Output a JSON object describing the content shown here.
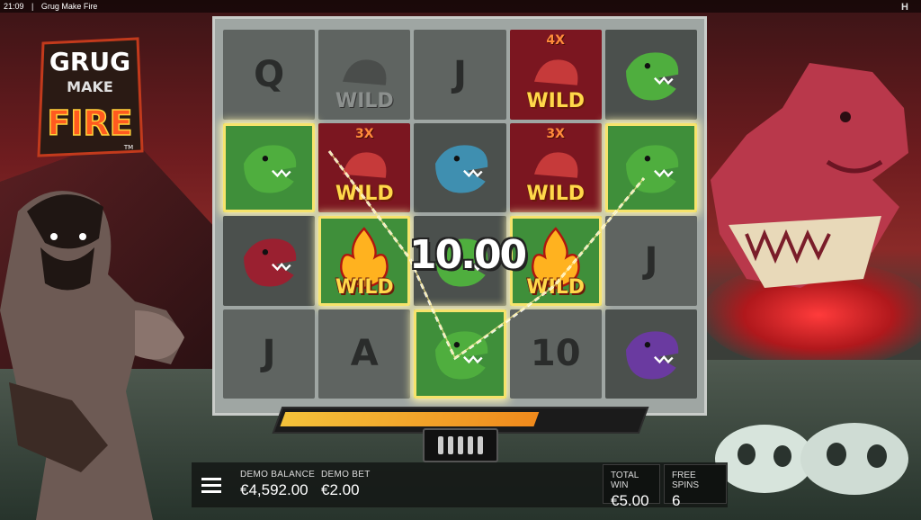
{
  "status_bar": {
    "time": "21:09",
    "separator": "|",
    "title": "Grug Make Fire",
    "provider_mark": "H"
  },
  "logo": {
    "line1": "GRUG",
    "line2": "MAKE",
    "line3": "FIRE",
    "tm": "TM"
  },
  "reels": [
    [
      {
        "type": "letter",
        "label": "Q"
      },
      {
        "type": "wild",
        "label": "WILD",
        "mult": ""
      },
      {
        "type": "letter",
        "label": "J"
      },
      {
        "type": "wild",
        "label": "WILD",
        "mult": "4X"
      },
      {
        "type": "dino",
        "color": "green",
        "label": ""
      }
    ],
    [
      {
        "type": "dino",
        "color": "green",
        "label": "",
        "win": true
      },
      {
        "type": "wild",
        "label": "WILD",
        "mult": "3X"
      },
      {
        "type": "dino",
        "color": "blue",
        "label": ""
      },
      {
        "type": "wild",
        "label": "WILD",
        "mult": "3X"
      },
      {
        "type": "dino",
        "color": "green",
        "label": "",
        "win": true
      }
    ],
    [
      {
        "type": "dino",
        "color": "red",
        "label": ""
      },
      {
        "type": "fire",
        "label": "WILD",
        "win": true
      },
      {
        "type": "dino",
        "color": "green",
        "label": ""
      },
      {
        "type": "fire",
        "label": "WILD",
        "win": true
      },
      {
        "type": "letter",
        "label": "J"
      }
    ],
    [
      {
        "type": "letter",
        "label": "J"
      },
      {
        "type": "letter",
        "label": "A"
      },
      {
        "type": "dino",
        "color": "green",
        "label": "",
        "win": true
      },
      {
        "type": "letter",
        "label": "10"
      },
      {
        "type": "dino",
        "color": "purple",
        "label": ""
      }
    ]
  ],
  "win_amount": "10.00",
  "progress": 0.72,
  "bottom_bar": {
    "balance_label": "DEMO BALANCE",
    "balance_value": "€4,592.00",
    "bet_label": "DEMO BET",
    "bet_value": "€2.00",
    "total_win_label": "TOTAL WIN",
    "total_win_value": "€5.00",
    "free_spins_label": "FREE SPINS",
    "free_spins_value": "6"
  },
  "colors": {
    "wild_text": "#ffd84a",
    "meter_fill": "#f08a1c",
    "dino_green": "#4fae3e",
    "dino_blue": "#3f8fb0",
    "dino_red": "#9a2030",
    "dino_purple": "#6a3aa0"
  }
}
